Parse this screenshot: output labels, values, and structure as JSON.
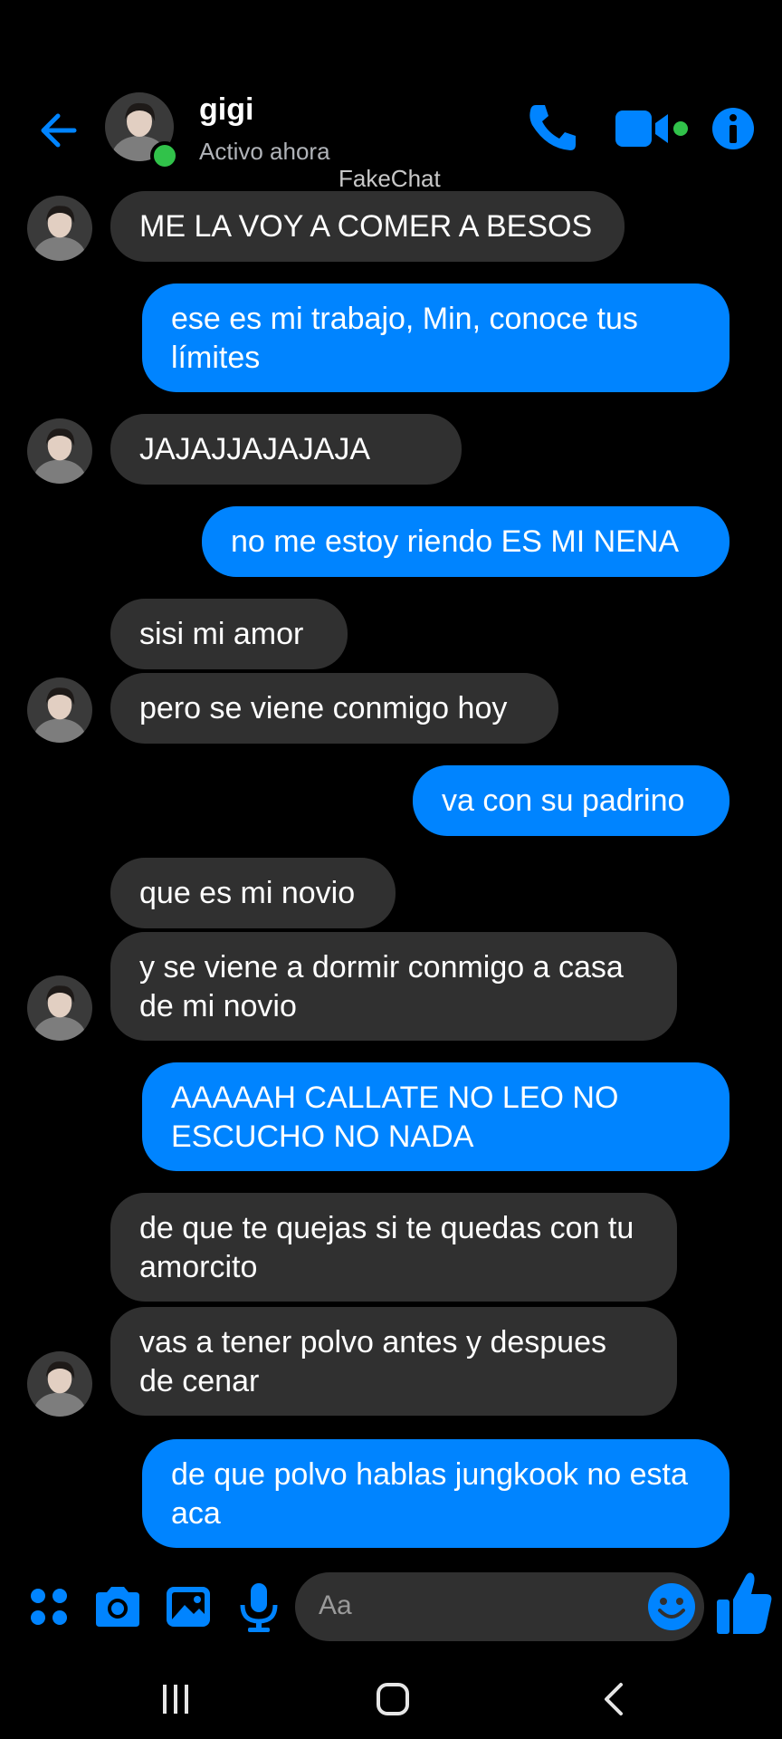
{
  "header": {
    "contact_name": "gigi",
    "status": "Activo ahora",
    "watermark": "FakeChat"
  },
  "messages": [
    {
      "from": "them",
      "text": "ME LA VOY A COMER A BESOS"
    },
    {
      "from": "me",
      "text": "ese es mi trabajo, Min, conoce tus límites"
    },
    {
      "from": "them",
      "text": "JAJAJJAJAJAJA"
    },
    {
      "from": "me",
      "text": "no me estoy riendo ES MI NENA"
    },
    {
      "from": "them",
      "text": "sisi mi amor"
    },
    {
      "from": "them",
      "text": "pero se viene conmigo hoy"
    },
    {
      "from": "me",
      "text": "va con su padrino"
    },
    {
      "from": "them",
      "text": "que es mi novio"
    },
    {
      "from": "them",
      "text": "y se viene a dormir conmigo a casa de mi novio"
    },
    {
      "from": "me",
      "text": "AAAAAH CALLATE NO LEO NO ESCUCHO NO NADA"
    },
    {
      "from": "them",
      "text": "de que te quejas si te quedas con tu amorcito"
    },
    {
      "from": "them",
      "text": "vas a tener polvo antes y despues de cenar"
    },
    {
      "from": "me",
      "text": "de que polvo hablas jungkook no esta aca"
    }
  ],
  "composer": {
    "placeholder": "Aa",
    "icons": [
      "apps-icon",
      "camera-icon",
      "gallery-icon",
      "mic-icon",
      "emoji-icon",
      "thumbs-up-icon"
    ]
  },
  "colors": {
    "accent": "#0084ff",
    "incoming_bubble": "#303030",
    "online": "#31c24a",
    "background": "#000000"
  }
}
